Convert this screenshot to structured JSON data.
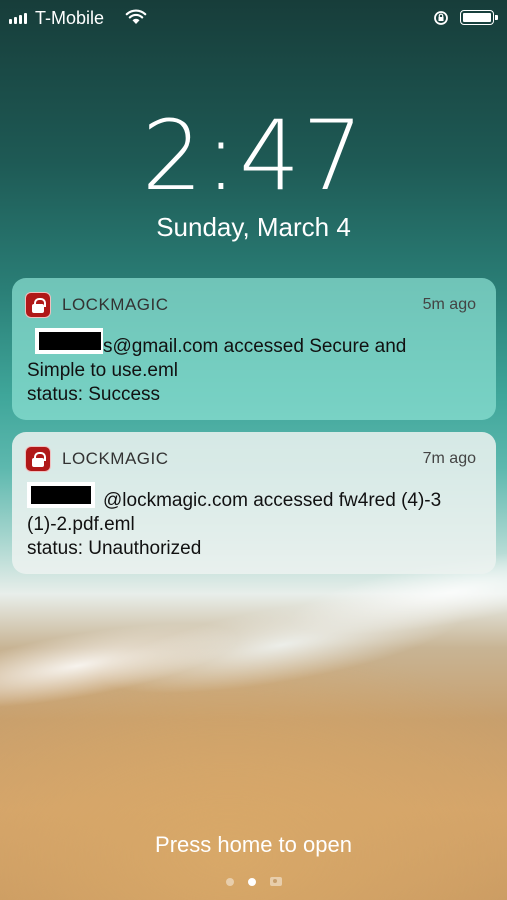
{
  "status_bar": {
    "carrier": "T-Mobile",
    "icons": [
      "signal-bars-icon",
      "wifi-icon",
      "rotation-lock-icon",
      "battery-icon"
    ]
  },
  "lock_screen": {
    "time": "2:47",
    "date": "Sunday, March 4",
    "hint": "Press home to open"
  },
  "notifications": [
    {
      "app": "LOCKMAGIC",
      "age": "5m ago",
      "email_suffix": "s@gmail.com accessed Secure and",
      "line2": "Simple to use.eml",
      "status": "status: Success"
    },
    {
      "app": "LOCKMAGIC",
      "age": "7m ago",
      "email_suffix": "@lockmagic.com accessed fw4red (4)-3",
      "line2": "(1)-2.pdf.eml",
      "status": "status: Unauthorized"
    }
  ],
  "page_indicator": {
    "pages": 3,
    "active": 2
  }
}
